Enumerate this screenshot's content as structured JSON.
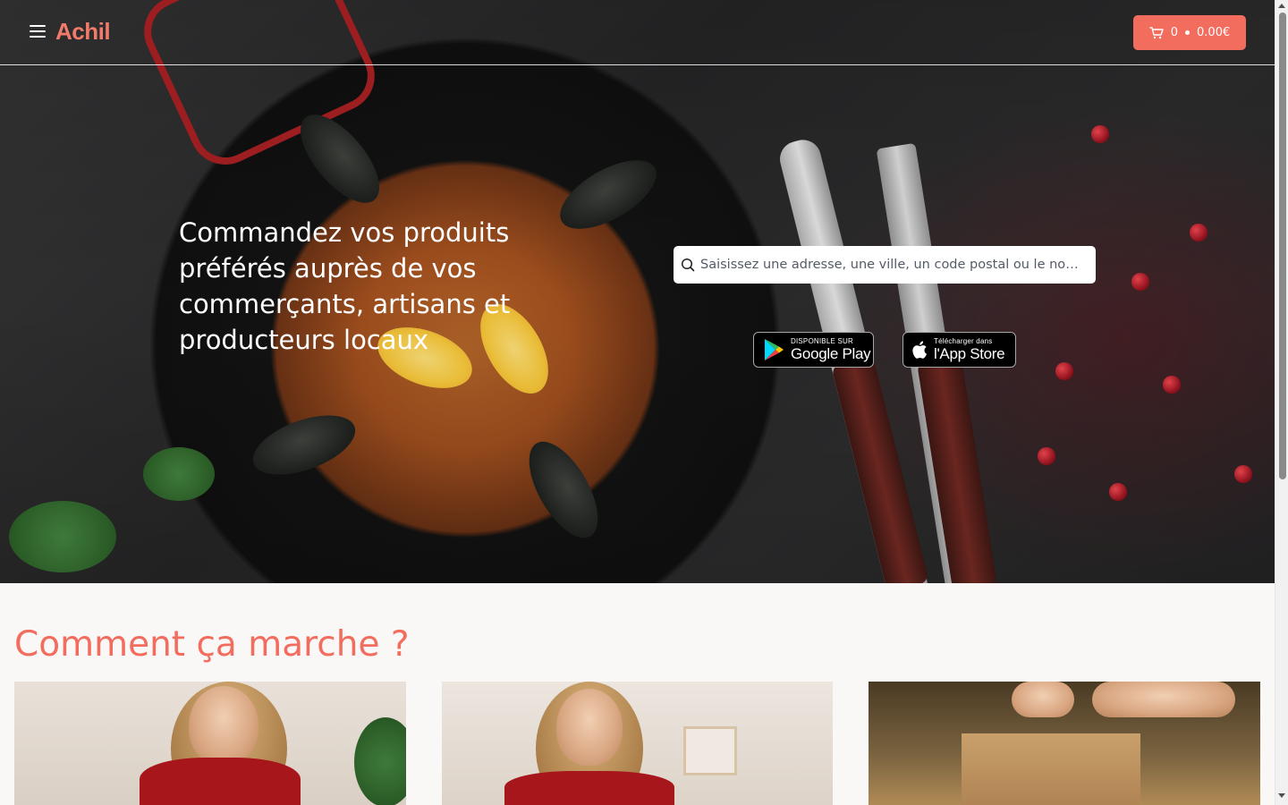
{
  "header": {
    "logo_text": "chil",
    "logo_mark": "A",
    "cart_count": "0",
    "cart_total": "0.00€"
  },
  "hero": {
    "title": "Commandez vos produits préférés auprès de vos commerçants, artisans et producteurs locaux",
    "search_placeholder": "Saisissez une adresse, une ville, un code postal ou le nom d'un commerce"
  },
  "badges": {
    "google_small": "DISPONIBLE SUR",
    "google_big": "Google Play",
    "apple_small": "Télécharger dans",
    "apple_big": "l'App Store"
  },
  "section": {
    "title": "Comment ça marche ?"
  },
  "colors": {
    "accent": "#f36d5f",
    "logo": "#f27a6a"
  },
  "icons": {
    "menu": "hamburger-menu-icon",
    "cart": "shopping-cart-icon",
    "search": "search-icon",
    "google_play": "google-play-icon",
    "apple": "apple-icon"
  }
}
